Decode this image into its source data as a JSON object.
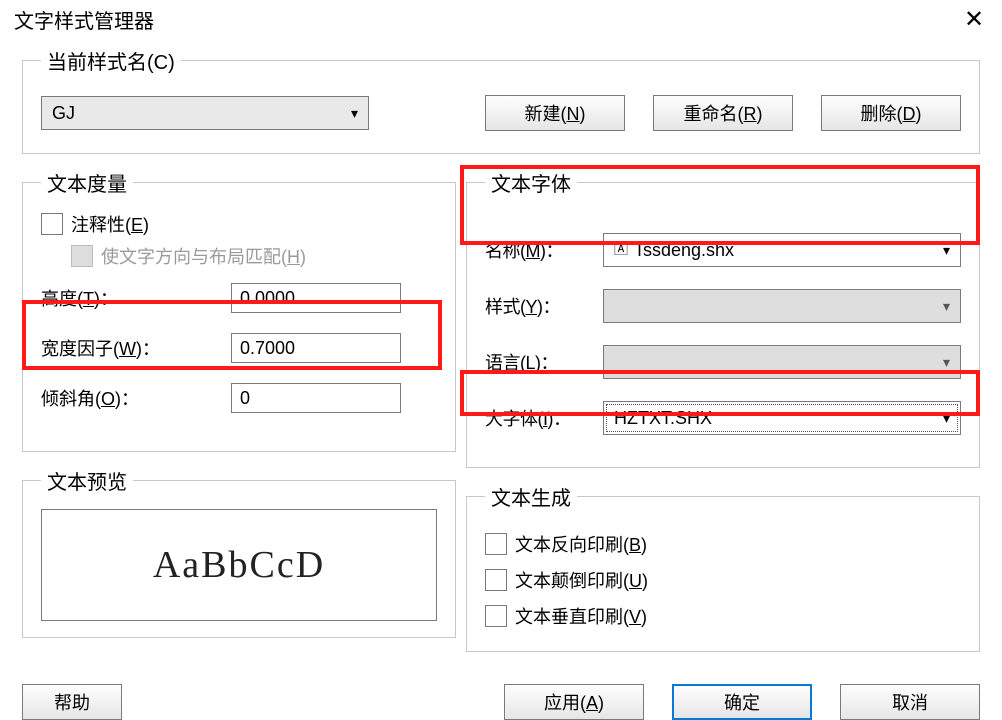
{
  "window": {
    "title": "文字样式管理器"
  },
  "currentStyle": {
    "legend": "当前样式名(C)",
    "value": "GJ",
    "newBtn": "新建(N)",
    "renameBtn": "重命名(R)",
    "deleteBtn": "删除(D)"
  },
  "measure": {
    "legend": "文本度量",
    "annotative": "注释性(E)",
    "matchOrient": "使文字方向与布局匹配(H)",
    "heightLabel": "高度(T)：",
    "heightValue": "0.0000",
    "widthLabel": "宽度因子(W)：",
    "widthValue": "0.7000",
    "obliqueLabel": "倾斜角(O)：",
    "obliqueValue": "0"
  },
  "font": {
    "legend": "文本字体",
    "nameLabel": "名称(M)：",
    "nameValue": "Tssdeng.shx",
    "styleLabel": "样式(Y)：",
    "langLabel": "语言(L)：",
    "bigFontLabel": "大字体(I)：",
    "bigFontValue": "HZTXT.SHX"
  },
  "preview": {
    "legend": "文本预览",
    "sample": "AaBbCcD"
  },
  "generate": {
    "legend": "文本生成",
    "backwards": "文本反向印刷(B)",
    "upsideDown": "文本颠倒印刷(U)",
    "vertical": "文本垂直印刷(V)"
  },
  "bottom": {
    "help": "帮助",
    "apply": "应用(A)",
    "ok": "确定",
    "cancel": "取消"
  }
}
